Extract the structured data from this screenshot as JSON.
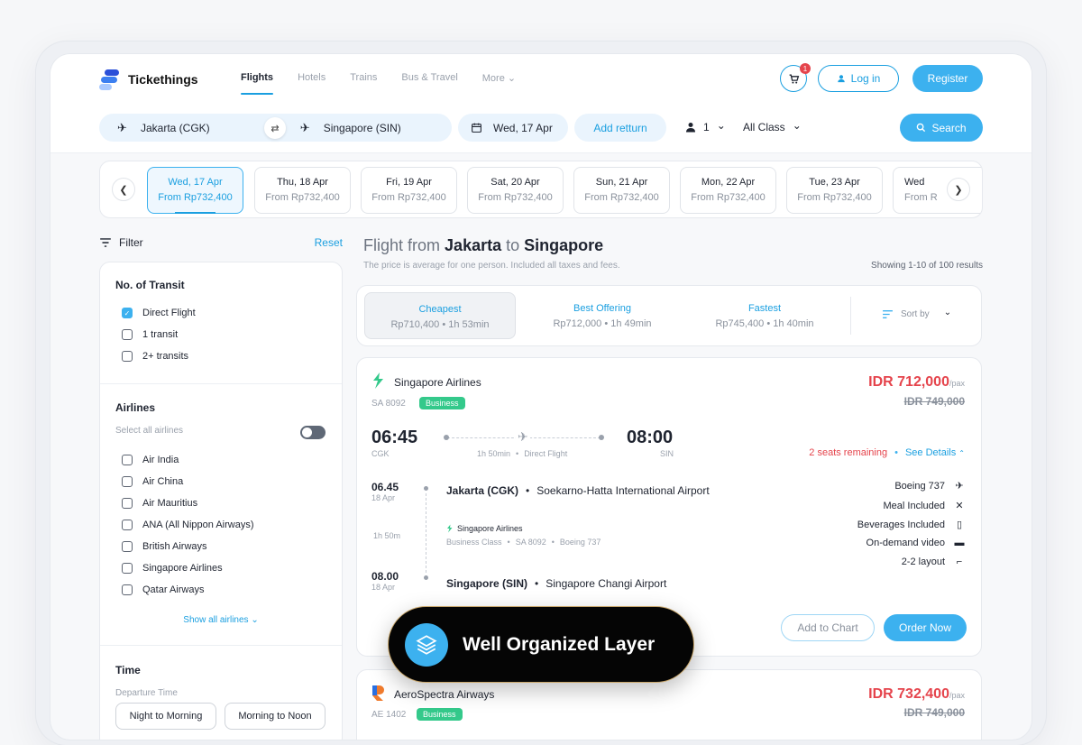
{
  "app": {
    "name": "Tickethings"
  },
  "nav": {
    "items": [
      "Flights",
      "Hotels",
      "Trains",
      "Bus & Travel",
      "More"
    ]
  },
  "header": {
    "cart_count": "1",
    "login": "Log in",
    "register": "Register"
  },
  "search": {
    "from": "Jakarta (CGK)",
    "to": "Singapore (SIN)",
    "date": "Wed, 17 Apr",
    "add_return": "Add retturn",
    "passengers": "1",
    "class": "All Class",
    "button": "Search"
  },
  "dates": [
    {
      "day": "Wed, 17 Apr",
      "price": "From Rp732,400",
      "selected": true
    },
    {
      "day": "Thu, 18 Apr",
      "price": "From Rp732,400"
    },
    {
      "day": "Fri, 19 Apr",
      "price": "From Rp732,400"
    },
    {
      "day": "Sat, 20 Apr",
      "price": "From Rp732,400"
    },
    {
      "day": "Sun, 21 Apr",
      "price": "From Rp732,400"
    },
    {
      "day": "Mon, 22 Apr",
      "price": "From Rp732,400"
    },
    {
      "day": "Tue, 23 Apr",
      "price": "From Rp732,400"
    },
    {
      "day": "Wed",
      "price": "From R"
    }
  ],
  "filter": {
    "title": "Filter",
    "reset": "Reset",
    "transit_title": "No. of Transit",
    "transit": [
      {
        "label": "Direct Flight",
        "checked": true
      },
      {
        "label": "1 transit",
        "checked": false
      },
      {
        "label": "2+ transits",
        "checked": false
      }
    ],
    "airlines_title": "Airlines",
    "select_all": "Select all airlines",
    "airlines": [
      "Air India",
      "Air China",
      "Air Mauritius",
      "ANA (All Nippon Airways)",
      "British Airways",
      "Singapore Airlines",
      "Qatar Airways"
    ],
    "show_all": "Show all airlines",
    "time_title": "Time",
    "departure_label": "Departure Time",
    "time_options": [
      "Night to Morning",
      "Morning to Noon"
    ]
  },
  "results": {
    "title_prefix": "Flight from",
    "origin": "Jakarta",
    "title_to": "to",
    "destination": "Singapore",
    "subtitle": "The price is average for one person. Included all taxes and fees.",
    "count": "Showing 1-10 of 100 results"
  },
  "sort": {
    "options": [
      {
        "label": "Cheapest",
        "value": "Rp710,400 • 1h 53min"
      },
      {
        "label": "Best Offering",
        "value": "Rp712,000 • 1h 49min"
      },
      {
        "label": "Fastest",
        "value": "Rp745,400 • 1h 40min"
      }
    ],
    "sort_by": "Sort by"
  },
  "flight1": {
    "airline": "Singapore Airlines",
    "code": "SA 8092",
    "badge": "Business",
    "price": "IDR 712,000",
    "per": "/pax",
    "old_price": "IDR 749,000",
    "dep_time": "06:45",
    "dep_code": "CGK",
    "arr_time": "08:00",
    "arr_code": "SIN",
    "duration": "1h 50min",
    "dot": "•",
    "type": "Direct Flight",
    "seats": "2 seats remaining",
    "see_details": "See Details",
    "detail": {
      "dep_time": "06.45",
      "dep_date": "18 Apr",
      "dep_city": "Jakarta (CGK)",
      "dep_airport": "Soekarno-Hatta International Airport",
      "duration": "1h 50m",
      "airline": "Singapore Airlines",
      "cabin": "Business Class",
      "code": "SA 8092",
      "aircraft": "Boeing 737",
      "arr_time": "08.00",
      "arr_date": "18 Apr",
      "arr_city": "Singapore (SIN)",
      "arr_airport": "Singapore Changi Airport"
    },
    "amenities": [
      "Boeing 737",
      "Meal Included",
      "Beverages Included",
      "On-demand video",
      "2-2 layout"
    ],
    "add_to_chart": "Add to Chart",
    "order_now": "Order Now"
  },
  "flight2": {
    "airline": "AeroSpectra Airways",
    "code": "AE 1402",
    "badge": "Business",
    "price": "IDR 732,400",
    "per": "/pax",
    "old_price": "IDR 749,000"
  },
  "overlay": {
    "label": "Well Organized Layer"
  },
  "colors": {
    "accent": "#3cb1ef",
    "price": "#e5444c",
    "badge": "#34c98b"
  }
}
